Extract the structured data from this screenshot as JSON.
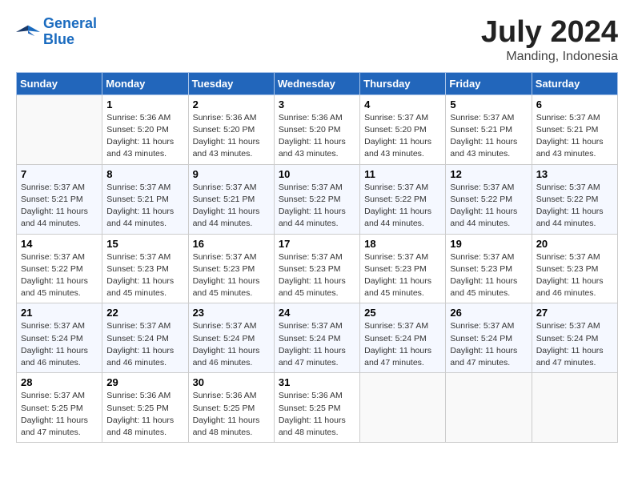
{
  "header": {
    "logo_line1": "General",
    "logo_line2": "Blue",
    "month": "July 2024",
    "location": "Manding, Indonesia"
  },
  "weekdays": [
    "Sunday",
    "Monday",
    "Tuesday",
    "Wednesday",
    "Thursday",
    "Friday",
    "Saturday"
  ],
  "weeks": [
    [
      {
        "day": "",
        "info": ""
      },
      {
        "day": "1",
        "info": "Sunrise: 5:36 AM\nSunset: 5:20 PM\nDaylight: 11 hours\nand 43 minutes."
      },
      {
        "day": "2",
        "info": "Sunrise: 5:36 AM\nSunset: 5:20 PM\nDaylight: 11 hours\nand 43 minutes."
      },
      {
        "day": "3",
        "info": "Sunrise: 5:36 AM\nSunset: 5:20 PM\nDaylight: 11 hours\nand 43 minutes."
      },
      {
        "day": "4",
        "info": "Sunrise: 5:37 AM\nSunset: 5:20 PM\nDaylight: 11 hours\nand 43 minutes."
      },
      {
        "day": "5",
        "info": "Sunrise: 5:37 AM\nSunset: 5:21 PM\nDaylight: 11 hours\nand 43 minutes."
      },
      {
        "day": "6",
        "info": "Sunrise: 5:37 AM\nSunset: 5:21 PM\nDaylight: 11 hours\nand 43 minutes."
      }
    ],
    [
      {
        "day": "7",
        "info": "Sunrise: 5:37 AM\nSunset: 5:21 PM\nDaylight: 11 hours\nand 44 minutes."
      },
      {
        "day": "8",
        "info": "Sunrise: 5:37 AM\nSunset: 5:21 PM\nDaylight: 11 hours\nand 44 minutes."
      },
      {
        "day": "9",
        "info": "Sunrise: 5:37 AM\nSunset: 5:21 PM\nDaylight: 11 hours\nand 44 minutes."
      },
      {
        "day": "10",
        "info": "Sunrise: 5:37 AM\nSunset: 5:22 PM\nDaylight: 11 hours\nand 44 minutes."
      },
      {
        "day": "11",
        "info": "Sunrise: 5:37 AM\nSunset: 5:22 PM\nDaylight: 11 hours\nand 44 minutes."
      },
      {
        "day": "12",
        "info": "Sunrise: 5:37 AM\nSunset: 5:22 PM\nDaylight: 11 hours\nand 44 minutes."
      },
      {
        "day": "13",
        "info": "Sunrise: 5:37 AM\nSunset: 5:22 PM\nDaylight: 11 hours\nand 44 minutes."
      }
    ],
    [
      {
        "day": "14",
        "info": "Sunrise: 5:37 AM\nSunset: 5:22 PM\nDaylight: 11 hours\nand 45 minutes."
      },
      {
        "day": "15",
        "info": "Sunrise: 5:37 AM\nSunset: 5:23 PM\nDaylight: 11 hours\nand 45 minutes."
      },
      {
        "day": "16",
        "info": "Sunrise: 5:37 AM\nSunset: 5:23 PM\nDaylight: 11 hours\nand 45 minutes."
      },
      {
        "day": "17",
        "info": "Sunrise: 5:37 AM\nSunset: 5:23 PM\nDaylight: 11 hours\nand 45 minutes."
      },
      {
        "day": "18",
        "info": "Sunrise: 5:37 AM\nSunset: 5:23 PM\nDaylight: 11 hours\nand 45 minutes."
      },
      {
        "day": "19",
        "info": "Sunrise: 5:37 AM\nSunset: 5:23 PM\nDaylight: 11 hours\nand 45 minutes."
      },
      {
        "day": "20",
        "info": "Sunrise: 5:37 AM\nSunset: 5:23 PM\nDaylight: 11 hours\nand 46 minutes."
      }
    ],
    [
      {
        "day": "21",
        "info": "Sunrise: 5:37 AM\nSunset: 5:24 PM\nDaylight: 11 hours\nand 46 minutes."
      },
      {
        "day": "22",
        "info": "Sunrise: 5:37 AM\nSunset: 5:24 PM\nDaylight: 11 hours\nand 46 minutes."
      },
      {
        "day": "23",
        "info": "Sunrise: 5:37 AM\nSunset: 5:24 PM\nDaylight: 11 hours\nand 46 minutes."
      },
      {
        "day": "24",
        "info": "Sunrise: 5:37 AM\nSunset: 5:24 PM\nDaylight: 11 hours\nand 47 minutes."
      },
      {
        "day": "25",
        "info": "Sunrise: 5:37 AM\nSunset: 5:24 PM\nDaylight: 11 hours\nand 47 minutes."
      },
      {
        "day": "26",
        "info": "Sunrise: 5:37 AM\nSunset: 5:24 PM\nDaylight: 11 hours\nand 47 minutes."
      },
      {
        "day": "27",
        "info": "Sunrise: 5:37 AM\nSunset: 5:24 PM\nDaylight: 11 hours\nand 47 minutes."
      }
    ],
    [
      {
        "day": "28",
        "info": "Sunrise: 5:37 AM\nSunset: 5:25 PM\nDaylight: 11 hours\nand 47 minutes."
      },
      {
        "day": "29",
        "info": "Sunrise: 5:36 AM\nSunset: 5:25 PM\nDaylight: 11 hours\nand 48 minutes."
      },
      {
        "day": "30",
        "info": "Sunrise: 5:36 AM\nSunset: 5:25 PM\nDaylight: 11 hours\nand 48 minutes."
      },
      {
        "day": "31",
        "info": "Sunrise: 5:36 AM\nSunset: 5:25 PM\nDaylight: 11 hours\nand 48 minutes."
      },
      {
        "day": "",
        "info": ""
      },
      {
        "day": "",
        "info": ""
      },
      {
        "day": "",
        "info": ""
      }
    ]
  ]
}
